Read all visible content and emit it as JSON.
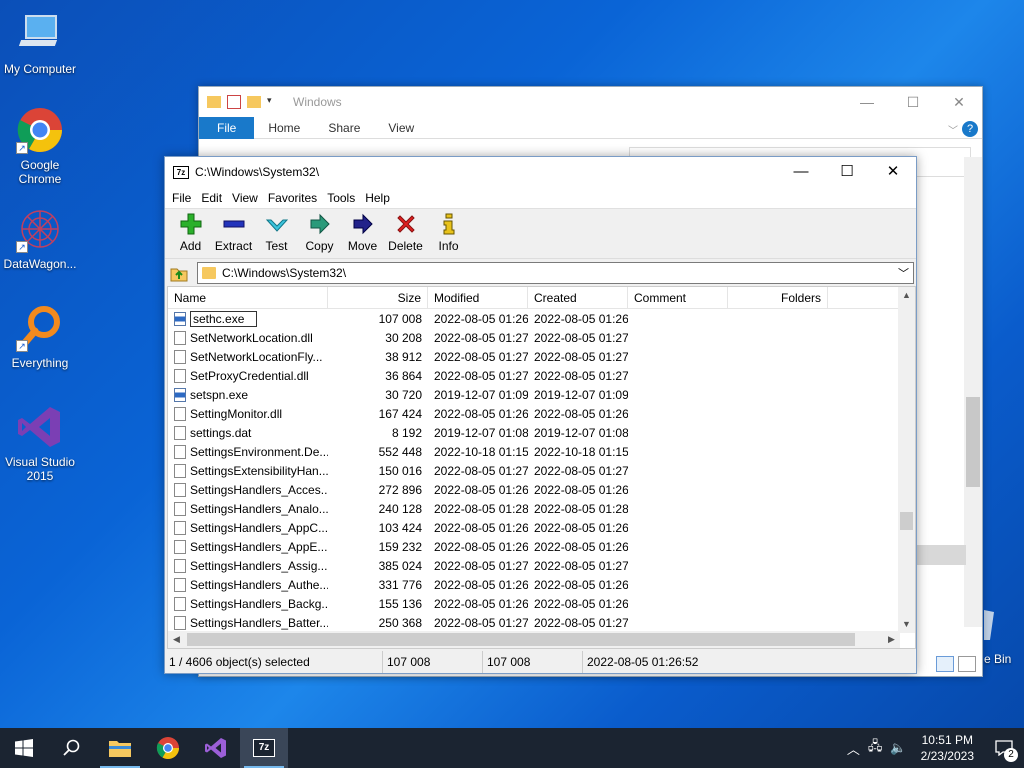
{
  "desktop": {
    "icons": [
      {
        "label": "My Computer"
      },
      {
        "label": "Google Chrome"
      },
      {
        "label": "DataWagon..."
      },
      {
        "label": "Everything"
      },
      {
        "label": "Visual Studio 2015"
      }
    ],
    "recycle_fragment": "e Bin"
  },
  "explorer": {
    "title": "Windows",
    "tabs": [
      "File",
      "Home",
      "Share",
      "View"
    ]
  },
  "sevenzip": {
    "title": "C:\\Windows\\System32\\",
    "menu": [
      "File",
      "Edit",
      "View",
      "Favorites",
      "Tools",
      "Help"
    ],
    "toolbar": [
      {
        "label": "Add",
        "icon": "plus-icon",
        "color": "#22aa22"
      },
      {
        "label": "Extract",
        "icon": "minus-icon",
        "color": "#2233aa"
      },
      {
        "label": "Test",
        "icon": "check-icon",
        "color": "#22aacc"
      },
      {
        "label": "Copy",
        "icon": "copy-arrow-icon",
        "color": "#229977"
      },
      {
        "label": "Move",
        "icon": "move-arrow-icon",
        "color": "#222288"
      },
      {
        "label": "Delete",
        "icon": "delete-x-icon",
        "color": "#dd2222"
      },
      {
        "label": "Info",
        "icon": "info-icon",
        "color": "#ccaa00"
      }
    ],
    "address": "C:\\Windows\\System32\\",
    "columns": [
      "Name",
      "Size",
      "Modified",
      "Created",
      "Comment",
      "Folders"
    ],
    "rows": [
      {
        "name": "sethc.exe",
        "type": "exe",
        "size": "107 008",
        "modified": "2022-08-05 01:26",
        "created": "2022-08-05 01:26",
        "editing": true
      },
      {
        "name": "SetNetworkLocation.dll",
        "type": "dll",
        "size": "30 208",
        "modified": "2022-08-05 01:27",
        "created": "2022-08-05 01:27"
      },
      {
        "name": "SetNetworkLocationFly...",
        "type": "dll",
        "size": "38 912",
        "modified": "2022-08-05 01:27",
        "created": "2022-08-05 01:27"
      },
      {
        "name": "SetProxyCredential.dll",
        "type": "dll",
        "size": "36 864",
        "modified": "2022-08-05 01:27",
        "created": "2022-08-05 01:27"
      },
      {
        "name": "setspn.exe",
        "type": "exe",
        "size": "30 720",
        "modified": "2019-12-07 01:09",
        "created": "2019-12-07 01:09"
      },
      {
        "name": "SettingMonitor.dll",
        "type": "dll",
        "size": "167 424",
        "modified": "2022-08-05 01:26",
        "created": "2022-08-05 01:26"
      },
      {
        "name": "settings.dat",
        "type": "dat",
        "size": "8 192",
        "modified": "2019-12-07 01:08",
        "created": "2019-12-07 01:08"
      },
      {
        "name": "SettingsEnvironment.De...",
        "type": "dll",
        "size": "552 448",
        "modified": "2022-10-18 01:15",
        "created": "2022-10-18 01:15"
      },
      {
        "name": "SettingsExtensibilityHan...",
        "type": "dll",
        "size": "150 016",
        "modified": "2022-08-05 01:27",
        "created": "2022-08-05 01:27"
      },
      {
        "name": "SettingsHandlers_Acces...",
        "type": "dll",
        "size": "272 896",
        "modified": "2022-08-05 01:26",
        "created": "2022-08-05 01:26"
      },
      {
        "name": "SettingsHandlers_Analo...",
        "type": "dll",
        "size": "240 128",
        "modified": "2022-08-05 01:28",
        "created": "2022-08-05 01:28"
      },
      {
        "name": "SettingsHandlers_AppC...",
        "type": "dll",
        "size": "103 424",
        "modified": "2022-08-05 01:26",
        "created": "2022-08-05 01:26"
      },
      {
        "name": "SettingsHandlers_AppE...",
        "type": "dll",
        "size": "159 232",
        "modified": "2022-08-05 01:26",
        "created": "2022-08-05 01:26"
      },
      {
        "name": "SettingsHandlers_Assig...",
        "type": "dll",
        "size": "385 024",
        "modified": "2022-08-05 01:27",
        "created": "2022-08-05 01:27"
      },
      {
        "name": "SettingsHandlers_Authe...",
        "type": "dll",
        "size": "331 776",
        "modified": "2022-08-05 01:26",
        "created": "2022-08-05 01:26"
      },
      {
        "name": "SettingsHandlers_Backg...",
        "type": "dll",
        "size": "155 136",
        "modified": "2022-08-05 01:26",
        "created": "2022-08-05 01:26"
      },
      {
        "name": "SettingsHandlers_Batter...",
        "type": "dll",
        "size": "250 368",
        "modified": "2022-08-05 01:27",
        "created": "2022-08-05 01:27"
      }
    ],
    "status": {
      "selection": "1 / 4606 object(s) selected",
      "size": "107 008",
      "packed": "107 008",
      "modified": "2022-08-05 01:26:52"
    }
  },
  "taskbar": {
    "apps": [
      "windows-start-icon",
      "search-icon",
      "file-explorer-icon",
      "chrome-icon",
      "visual-studio-icon",
      "7zip-icon"
    ],
    "time": "10:51 PM",
    "date": "2/23/2023",
    "notification_count": "2"
  }
}
